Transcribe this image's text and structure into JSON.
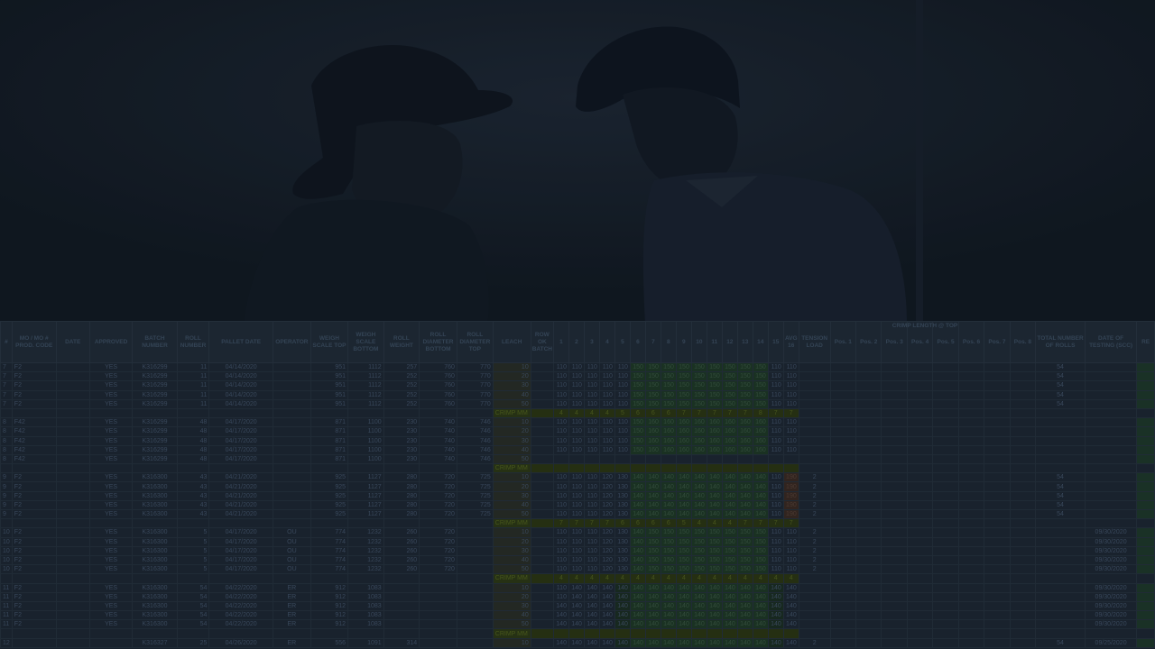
{
  "sheet": {
    "group_header": "CRIMP LENGTH @ TOP",
    "headers": {
      "col_a": "#",
      "mo": "MO / MO # PROD. CODE",
      "date": "DATE",
      "approved": "APPROVED",
      "batch": "BATCH NUMBER",
      "roll": "ROLL NUMBER",
      "pallet_date": "PALLET DATE",
      "operator": "OPERATOR",
      "weigh_top": "WEIGH SCALE TOP",
      "weigh_bottom": "WEIGH SCALE BOTTOM",
      "roll_weight": "ROLL WEIGHT",
      "diam_bottom": "ROLL DIAMETER BOTTOM",
      "diam_top": "ROLL DIAMETER TOP",
      "leach": "LEACH",
      "ok": "ROW OK BATCH",
      "p1": "1",
      "p2": "2",
      "p3": "3",
      "p4": "4",
      "p5": "5",
      "p6": "6",
      "p7": "7",
      "p8": "8",
      "p9": "9",
      "p10": "10",
      "p11": "11",
      "p12": "12",
      "p13": "13",
      "p14": "14",
      "p15": "15",
      "p16": "AVG 16",
      "tension": "TENSION LOAD",
      "pos1": "Pos. 1",
      "pos2": "Pos. 2",
      "pos3": "Pos. 3",
      "pos4": "Pos. 4",
      "pos5": "Pos. 5",
      "pos6": "Pos. 6",
      "pos7": "Pos. 7",
      "pos8": "Pos. 8",
      "total": "TOTAL NUMBER OF ROLLS",
      "tested": "DATE OF TESTING (SCC)",
      "extra": "RE"
    },
    "rows": [
      {
        "n": "7",
        "mo": "F2",
        "ap": "YES",
        "batch": "K316299",
        "roll": "11",
        "pd": "04/14/2020",
        "op": "",
        "wt": "951",
        "wb": "1112",
        "rw": "257",
        "db": "760",
        "dt": "770",
        "le": "10",
        "v": [
          "110",
          "110",
          "110",
          "110",
          "110",
          "150",
          "150",
          "150",
          "150",
          "150",
          "150",
          "150",
          "150",
          "150",
          "110",
          "110"
        ],
        "t": "",
        "tot": "54",
        "dts": ""
      },
      {
        "n": "7",
        "mo": "F2",
        "ap": "YES",
        "batch": "K316299",
        "roll": "11",
        "pd": "04/14/2020",
        "op": "",
        "wt": "951",
        "wb": "1112",
        "rw": "252",
        "db": "760",
        "dt": "770",
        "le": "20",
        "v": [
          "110",
          "110",
          "110",
          "110",
          "110",
          "150",
          "150",
          "150",
          "150",
          "150",
          "150",
          "150",
          "150",
          "150",
          "110",
          "110"
        ],
        "t": "",
        "tot": "54",
        "dts": ""
      },
      {
        "n": "7",
        "mo": "F2",
        "ap": "YES",
        "batch": "K316299",
        "roll": "11",
        "pd": "04/14/2020",
        "op": "",
        "wt": "951",
        "wb": "1112",
        "rw": "252",
        "db": "760",
        "dt": "770",
        "le": "30",
        "v": [
          "110",
          "110",
          "110",
          "110",
          "110",
          "150",
          "150",
          "150",
          "150",
          "150",
          "150",
          "150",
          "150",
          "150",
          "110",
          "110"
        ],
        "t": "",
        "tot": "54",
        "dts": ""
      },
      {
        "n": "7",
        "mo": "F2",
        "ap": "YES",
        "batch": "K316299",
        "roll": "11",
        "pd": "04/14/2020",
        "op": "",
        "wt": "951",
        "wb": "1112",
        "rw": "252",
        "db": "760",
        "dt": "770",
        "le": "40",
        "v": [
          "110",
          "110",
          "110",
          "110",
          "110",
          "150",
          "150",
          "150",
          "150",
          "150",
          "150",
          "150",
          "150",
          "150",
          "110",
          "110"
        ],
        "t": "",
        "tot": "54",
        "dts": ""
      },
      {
        "n": "7",
        "mo": "F2",
        "ap": "YES",
        "batch": "K316299",
        "roll": "11",
        "pd": "04/14/2020",
        "op": "",
        "wt": "951",
        "wb": "1112",
        "rw": "252",
        "db": "760",
        "dt": "770",
        "le": "50",
        "v": [
          "110",
          "110",
          "110",
          "110",
          "110",
          "150",
          "150",
          "150",
          "150",
          "150",
          "150",
          "150",
          "150",
          "150",
          "110",
          "110"
        ],
        "t": "",
        "tot": "54",
        "dts": ""
      },
      {
        "crimp": true,
        "label": "CRIMP MM",
        "v": [
          "4",
          "4",
          "4",
          "4",
          "5",
          "6",
          "6",
          "6",
          "7",
          "7",
          "7",
          "7",
          "7",
          "8",
          "7",
          "7"
        ]
      },
      {
        "n": "8",
        "mo": "F42",
        "ap": "YES",
        "batch": "K316299",
        "roll": "48",
        "pd": "04/17/2020",
        "op": "",
        "wt": "871",
        "wb": "1100",
        "rw": "230",
        "db": "740",
        "dt": "746",
        "le": "10",
        "v": [
          "110",
          "110",
          "110",
          "110",
          "110",
          "150",
          "160",
          "160",
          "160",
          "160",
          "160",
          "160",
          "160",
          "160",
          "110",
          "110"
        ],
        "t": "",
        "tot": "",
        "dts": ""
      },
      {
        "n": "8",
        "mo": "F42",
        "ap": "YES",
        "batch": "K316299",
        "roll": "48",
        "pd": "04/17/2020",
        "op": "",
        "wt": "871",
        "wb": "1100",
        "rw": "230",
        "db": "740",
        "dt": "746",
        "le": "20",
        "v": [
          "110",
          "110",
          "110",
          "110",
          "110",
          "150",
          "160",
          "160",
          "160",
          "160",
          "160",
          "160",
          "160",
          "160",
          "110",
          "110"
        ],
        "t": "",
        "tot": "",
        "dts": ""
      },
      {
        "n": "8",
        "mo": "F42",
        "ap": "YES",
        "batch": "K316299",
        "roll": "48",
        "pd": "04/17/2020",
        "op": "",
        "wt": "871",
        "wb": "1100",
        "rw": "230",
        "db": "740",
        "dt": "746",
        "le": "30",
        "v": [
          "110",
          "110",
          "110",
          "110",
          "110",
          "150",
          "160",
          "160",
          "160",
          "160",
          "160",
          "160",
          "160",
          "160",
          "110",
          "110"
        ],
        "t": "",
        "tot": "",
        "dts": ""
      },
      {
        "n": "8",
        "mo": "F42",
        "ap": "YES",
        "batch": "K316299",
        "roll": "48",
        "pd": "04/17/2020",
        "op": "",
        "wt": "871",
        "wb": "1100",
        "rw": "230",
        "db": "740",
        "dt": "746",
        "le": "40",
        "v": [
          "110",
          "110",
          "110",
          "110",
          "110",
          "150",
          "160",
          "160",
          "160",
          "160",
          "160",
          "160",
          "160",
          "160",
          "110",
          "110"
        ],
        "t": "",
        "tot": "",
        "dts": ""
      },
      {
        "n": "8",
        "mo": "F42",
        "ap": "YES",
        "batch": "K316299",
        "roll": "48",
        "pd": "04/17/2020",
        "op": "",
        "wt": "871",
        "wb": "1100",
        "rw": "230",
        "db": "740",
        "dt": "746",
        "le": "50",
        "v": [
          "",
          "",
          "",
          "",
          "",
          "",
          "",
          "",
          "",
          "",
          "",
          "",
          "",
          "",
          "",
          ""
        ],
        "t": "",
        "tot": "",
        "dts": ""
      },
      {
        "crimp": true,
        "label": "CRIMP MM",
        "v": [
          "",
          "",
          "",
          "",
          "",
          "",
          "",
          "",
          "",
          "",
          "",
          "",
          "",
          "",
          "",
          ""
        ]
      },
      {
        "n": "9",
        "mo": "F2",
        "ap": "YES",
        "batch": "K316300",
        "roll": "43",
        "pd": "04/21/2020",
        "op": "",
        "wt": "925",
        "wb": "1127",
        "rw": "280",
        "db": "720",
        "dt": "725",
        "le": "10",
        "v": [
          "110",
          "110",
          "110",
          "120",
          "130",
          "140",
          "140",
          "140",
          "140",
          "140",
          "140",
          "140",
          "140",
          "140",
          "110",
          "190"
        ],
        "t": "2",
        "tot": "54",
        "dts": ""
      },
      {
        "n": "9",
        "mo": "F2",
        "ap": "YES",
        "batch": "K316300",
        "roll": "43",
        "pd": "04/21/2020",
        "op": "",
        "wt": "925",
        "wb": "1127",
        "rw": "280",
        "db": "720",
        "dt": "725",
        "le": "20",
        "v": [
          "110",
          "110",
          "110",
          "120",
          "130",
          "140",
          "140",
          "140",
          "140",
          "140",
          "140",
          "140",
          "140",
          "140",
          "110",
          "190"
        ],
        "t": "2",
        "tot": "54",
        "dts": ""
      },
      {
        "n": "9",
        "mo": "F2",
        "ap": "YES",
        "batch": "K316300",
        "roll": "43",
        "pd": "04/21/2020",
        "op": "",
        "wt": "925",
        "wb": "1127",
        "rw": "280",
        "db": "720",
        "dt": "725",
        "le": "30",
        "v": [
          "110",
          "110",
          "110",
          "120",
          "130",
          "140",
          "140",
          "140",
          "140",
          "140",
          "140",
          "140",
          "140",
          "140",
          "110",
          "190"
        ],
        "t": "2",
        "tot": "54",
        "dts": ""
      },
      {
        "n": "9",
        "mo": "F2",
        "ap": "YES",
        "batch": "K316300",
        "roll": "43",
        "pd": "04/21/2020",
        "op": "",
        "wt": "925",
        "wb": "1127",
        "rw": "280",
        "db": "720",
        "dt": "725",
        "le": "40",
        "v": [
          "110",
          "110",
          "110",
          "120",
          "130",
          "140",
          "140",
          "140",
          "140",
          "140",
          "140",
          "140",
          "140",
          "140",
          "110",
          "190"
        ],
        "t": "2",
        "tot": "54",
        "dts": ""
      },
      {
        "n": "9",
        "mo": "F2",
        "ap": "YES",
        "batch": "K316300",
        "roll": "43",
        "pd": "04/21/2020",
        "op": "",
        "wt": "925",
        "wb": "1127",
        "rw": "280",
        "db": "720",
        "dt": "725",
        "le": "50",
        "v": [
          "110",
          "110",
          "110",
          "120",
          "130",
          "140",
          "140",
          "140",
          "140",
          "140",
          "140",
          "140",
          "140",
          "140",
          "110",
          "190"
        ],
        "t": "2",
        "tot": "54",
        "dts": ""
      },
      {
        "crimp": true,
        "label": "CRIMP MM",
        "v": [
          "7",
          "7",
          "7",
          "7",
          "6",
          "6",
          "6",
          "6",
          "5",
          "4",
          "4",
          "4",
          "7",
          "7",
          "7",
          "7"
        ]
      },
      {
        "n": "10",
        "mo": "F2",
        "ap": "YES",
        "batch": "K316300",
        "roll": "5",
        "pd": "04/17/2020",
        "op": "OU",
        "wt": "774",
        "wb": "1232",
        "rw": "260",
        "db": "720",
        "dt": "",
        "le": "10",
        "v": [
          "110",
          "110",
          "110",
          "120",
          "130",
          "140",
          "150",
          "150",
          "150",
          "150",
          "150",
          "150",
          "150",
          "150",
          "110",
          "110"
        ],
        "t": "2",
        "tot": "",
        "dts": "09/30/2020"
      },
      {
        "n": "10",
        "mo": "F2",
        "ap": "YES",
        "batch": "K316300",
        "roll": "5",
        "pd": "04/17/2020",
        "op": "OU",
        "wt": "774",
        "wb": "1232",
        "rw": "260",
        "db": "720",
        "dt": "",
        "le": "20",
        "v": [
          "110",
          "110",
          "110",
          "120",
          "130",
          "140",
          "150",
          "150",
          "150",
          "150",
          "150",
          "150",
          "150",
          "150",
          "110",
          "110"
        ],
        "t": "2",
        "tot": "",
        "dts": "09/30/2020"
      },
      {
        "n": "10",
        "mo": "F2",
        "ap": "YES",
        "batch": "K316300",
        "roll": "5",
        "pd": "04/17/2020",
        "op": "OU",
        "wt": "774",
        "wb": "1232",
        "rw": "260",
        "db": "720",
        "dt": "",
        "le": "30",
        "v": [
          "110",
          "110",
          "110",
          "120",
          "130",
          "140",
          "150",
          "150",
          "150",
          "150",
          "150",
          "150",
          "150",
          "150",
          "110",
          "110"
        ],
        "t": "2",
        "tot": "",
        "dts": "09/30/2020"
      },
      {
        "n": "10",
        "mo": "F2",
        "ap": "YES",
        "batch": "K316300",
        "roll": "5",
        "pd": "04/17/2020",
        "op": "OU",
        "wt": "774",
        "wb": "1232",
        "rw": "260",
        "db": "720",
        "dt": "",
        "le": "40",
        "v": [
          "110",
          "110",
          "110",
          "120",
          "130",
          "140",
          "150",
          "150",
          "150",
          "150",
          "150",
          "150",
          "150",
          "150",
          "110",
          "110"
        ],
        "t": "2",
        "tot": "",
        "dts": "09/30/2020"
      },
      {
        "n": "10",
        "mo": "F2",
        "ap": "YES",
        "batch": "K316300",
        "roll": "5",
        "pd": "04/17/2020",
        "op": "OU",
        "wt": "774",
        "wb": "1232",
        "rw": "260",
        "db": "720",
        "dt": "",
        "le": "50",
        "v": [
          "110",
          "110",
          "110",
          "120",
          "130",
          "140",
          "150",
          "150",
          "150",
          "150",
          "150",
          "150",
          "150",
          "150",
          "110",
          "110"
        ],
        "t": "2",
        "tot": "",
        "dts": "09/30/2020"
      },
      {
        "crimp": true,
        "label": "CRIMP MM",
        "v": [
          "4",
          "4",
          "4",
          "4",
          "4",
          "4",
          "4",
          "4",
          "4",
          "4",
          "4",
          "4",
          "4",
          "4",
          "4",
          "4"
        ]
      },
      {
        "n": "11",
        "mo": "F2",
        "ap": "YES",
        "batch": "K316300",
        "roll": "54",
        "pd": "04/22/2020",
        "op": "ER",
        "wt": "912",
        "wb": "1083",
        "rw": "",
        "db": "",
        "dt": "",
        "le": "10",
        "v": [
          "110",
          "140",
          "140",
          "140",
          "140",
          "140",
          "140",
          "140",
          "140",
          "140",
          "140",
          "140",
          "140",
          "140",
          "140",
          "140"
        ],
        "t": "",
        "tot": "",
        "dts": "09/30/2020"
      },
      {
        "n": "11",
        "mo": "F2",
        "ap": "YES",
        "batch": "K316300",
        "roll": "54",
        "pd": "04/22/2020",
        "op": "ER",
        "wt": "912",
        "wb": "1083",
        "rw": "",
        "db": "",
        "dt": "",
        "le": "20",
        "v": [
          "110",
          "140",
          "140",
          "140",
          "140",
          "140",
          "140",
          "140",
          "140",
          "140",
          "140",
          "140",
          "140",
          "140",
          "140",
          "140"
        ],
        "t": "",
        "tot": "",
        "dts": "09/30/2020"
      },
      {
        "n": "11",
        "mo": "F2",
        "ap": "YES",
        "batch": "K316300",
        "roll": "54",
        "pd": "04/22/2020",
        "op": "ER",
        "wt": "912",
        "wb": "1083",
        "rw": "",
        "db": "",
        "dt": "",
        "le": "30",
        "v": [
          "140",
          "140",
          "140",
          "140",
          "140",
          "140",
          "140",
          "140",
          "140",
          "140",
          "140",
          "140",
          "140",
          "140",
          "140",
          "140"
        ],
        "t": "",
        "tot": "",
        "dts": "09/30/2020"
      },
      {
        "n": "11",
        "mo": "F2",
        "ap": "YES",
        "batch": "K316300",
        "roll": "54",
        "pd": "04/22/2020",
        "op": "ER",
        "wt": "912",
        "wb": "1083",
        "rw": "",
        "db": "",
        "dt": "",
        "le": "40",
        "v": [
          "140",
          "140",
          "140",
          "140",
          "140",
          "140",
          "140",
          "140",
          "140",
          "140",
          "140",
          "140",
          "140",
          "140",
          "140",
          "140"
        ],
        "t": "",
        "tot": "",
        "dts": "09/30/2020"
      },
      {
        "n": "11",
        "mo": "F2",
        "ap": "YES",
        "batch": "K316300",
        "roll": "54",
        "pd": "04/22/2020",
        "op": "ER",
        "wt": "912",
        "wb": "1083",
        "rw": "",
        "db": "",
        "dt": "",
        "le": "50",
        "v": [
          "140",
          "140",
          "140",
          "140",
          "140",
          "140",
          "140",
          "140",
          "140",
          "140",
          "140",
          "140",
          "140",
          "140",
          "140",
          "140"
        ],
        "t": "",
        "tot": "",
        "dts": "09/30/2020"
      },
      {
        "crimp": true,
        "label": "CRIMP MM",
        "v": [
          "",
          "",
          "",
          "",
          "",
          "",
          "",
          "",
          "",
          "",
          "",
          "",
          "",
          "",
          "",
          ""
        ]
      },
      {
        "n": "12",
        "mo": "",
        "ap": "",
        "batch": "K316327",
        "roll": "25",
        "pd": "04/26/2020",
        "op": "ER",
        "wt": "556",
        "wb": "1091",
        "rw": "314",
        "db": "",
        "dt": "",
        "le": "10",
        "v": [
          "140",
          "140",
          "140",
          "140",
          "140",
          "140",
          "140",
          "140",
          "140",
          "140",
          "140",
          "140",
          "140",
          "140",
          "140",
          "140"
        ],
        "t": "2",
        "tot": "54",
        "dts": "09/25/2020"
      }
    ]
  }
}
